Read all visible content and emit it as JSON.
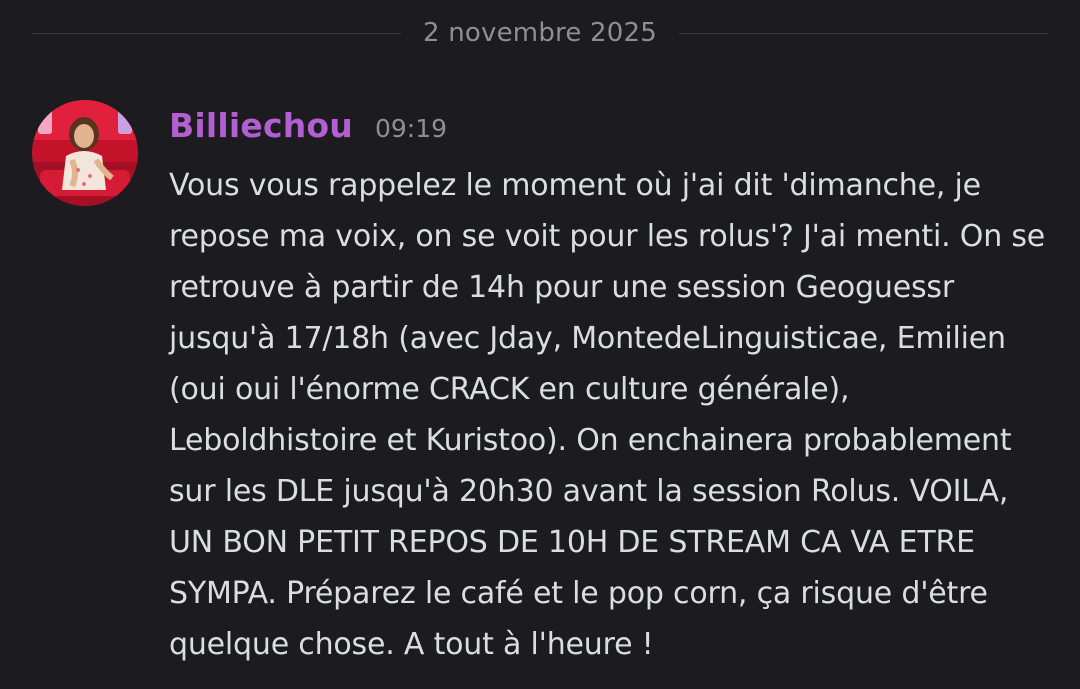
{
  "divider": {
    "date": "2 novembre 2025"
  },
  "message": {
    "author": "Billiechou",
    "author_color": "#b15fd1",
    "time": "09:19",
    "avatar_icon": "user-avatar",
    "text": "Vous vous rappelez le moment où j'ai dit 'dimanche, je repose ma voix, on se voit pour les rolus'? J'ai menti. On se retrouve à partir de 14h pour une session Geoguessr jusqu'à 17/18h (avec Jday, MontedeLinguisticae, Emilien (oui oui l'énorme CRACK en culture générale), Leboldhistoire et Kuristoo). On enchainera probablement sur les DLE jusqu'à 20h30 avant la session Rolus. VOILA, UN BON PETIT REPOS DE 10H DE STREAM CA VA ETRE SYMPA. Préparez le café et le pop corn, ça risque d'être quelque chose. A tout à l'heure !"
  },
  "colors": {
    "background": "#1b1b20",
    "text": "#dbdee1",
    "muted": "#8c8f97"
  }
}
